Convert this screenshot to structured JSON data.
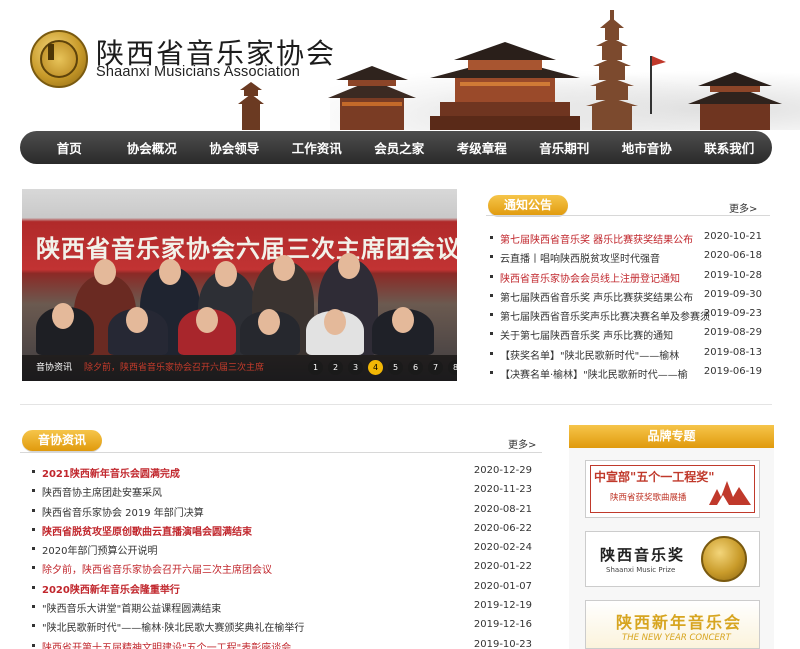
{
  "site": {
    "name_cn": "陕西省音乐家协会",
    "name_en": "Shaanxi Musicians Association"
  },
  "nav": {
    "items": [
      "首页",
      "协会概况",
      "协会领导",
      "工作资讯",
      "会员之家",
      "考级章程",
      "音乐期刊",
      "地市音协",
      "联系我们"
    ]
  },
  "banner": {
    "slogan": "陕西省音乐家协会六届三次主席团会议",
    "label": "音协资讯",
    "caption": "除夕前，陕西省音乐家协会召开六届三次主席",
    "slides": [
      "1",
      "2",
      "3",
      "4",
      "5",
      "6",
      "7",
      "8"
    ],
    "active_index": 3
  },
  "notice": {
    "title": "通知公告",
    "more": "更多>",
    "items": [
      {
        "text": "第七届陕西省音乐奖 器乐比赛获奖结果公布",
        "date": "2020-10-21",
        "red": true
      },
      {
        "text": "云直播丨唱响陕西脱贫攻坚时代强音",
        "date": "2020-06-18",
        "red": false
      },
      {
        "text": "陕西省音乐家协会会员线上注册登记通知",
        "date": "2019-10-28",
        "red": true
      },
      {
        "text": "第七届陕西省音乐奖 声乐比赛获奖结果公布",
        "date": "2019-09-30",
        "red": false
      },
      {
        "text": "第七届陕西省音乐奖声乐比赛决赛名单及参赛须",
        "date": "2019-09-23",
        "red": false
      },
      {
        "text": "关于第七届陕西音乐奖 声乐比赛的通知",
        "date": "2019-08-29",
        "red": false
      },
      {
        "text": "【获奖名单】\"陕北民歌新时代\"——榆林",
        "date": "2019-08-13",
        "red": false
      },
      {
        "text": "【决赛名单·榆林】\"陕北民歌新时代——榆",
        "date": "2019-06-19",
        "red": false
      }
    ]
  },
  "news": {
    "title": "音协资讯",
    "more": "更多>",
    "items": [
      {
        "text": "2021陕西新年音乐会圆满完成",
        "date": "2020-12-29",
        "red": true,
        "bold": true
      },
      {
        "text": "陕西音协主席团赴安塞采风",
        "date": "2020-11-23",
        "red": false,
        "bold": false
      },
      {
        "text": "陕西省音乐家协会 2019 年部门决算",
        "date": "2020-08-21",
        "red": false,
        "bold": false
      },
      {
        "text": "陕西省脱贫攻坚原创歌曲云直播演唱会圆满结束",
        "date": "2020-06-22",
        "red": true,
        "bold": true
      },
      {
        "text": "2020年部门预算公开说明",
        "date": "2020-02-24",
        "red": false,
        "bold": false
      },
      {
        "text": "除夕前，陕西省音乐家协会召开六届三次主席团会议",
        "date": "2020-01-22",
        "red": true,
        "bold": false
      },
      {
        "text": "2020陕西新年音乐会隆重举行",
        "date": "2020-01-07",
        "red": true,
        "bold": true
      },
      {
        "text": "\"陕西音乐大讲堂\"首期公益课程圆满结束",
        "date": "2019-12-19",
        "red": false,
        "bold": false
      },
      {
        "text": "\"陕北民歌新时代\"——榆林·陕北民歌大赛颁奖典礼在榆举行",
        "date": "2019-12-16",
        "red": false,
        "bold": false
      },
      {
        "text": "陕西省开第十五届精神文明建设\"五个一工程\"表彰座谈会",
        "date": "2019-10-23",
        "red": true,
        "bold": false
      }
    ]
  },
  "brand": {
    "title": "品牌专题",
    "promo1": {
      "title": "中宣部\"五个一工程奖\"",
      "subtitle": "陕西省获奖歌曲展播"
    },
    "promo2": {
      "title": "陕西音乐奖",
      "subtitle": "Shaanxi Music Prize"
    },
    "promo3": {
      "title": "陕西新年音乐会",
      "subtitle": "THE NEW YEAR CONCERT"
    }
  }
}
